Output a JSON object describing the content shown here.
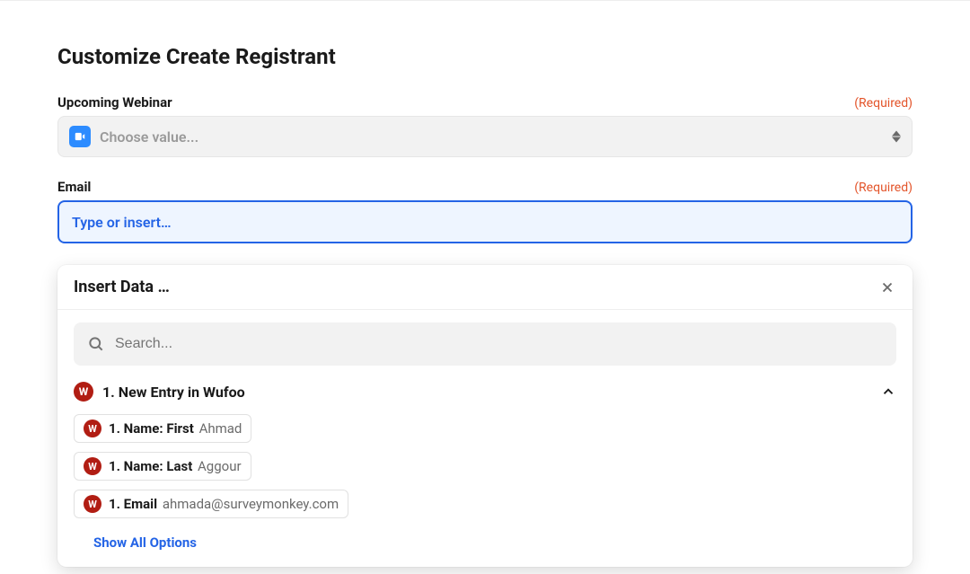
{
  "title": "Customize Create Registrant",
  "fields": {
    "webinar": {
      "label": "Upcoming Webinar",
      "required": "(Required)",
      "placeholder": "Choose value...",
      "icon": "zoom-icon"
    },
    "email": {
      "label": "Email",
      "required": "(Required)",
      "placeholder": "Type or insert…"
    }
  },
  "dropdown": {
    "title": "Insert Data …",
    "search_placeholder": "Search...",
    "group": {
      "icon": "wufoo-icon",
      "title": "1. New Entry in Wufoo",
      "expanded": true
    },
    "options": [
      {
        "label": "1. Name: First",
        "value": "Ahmad"
      },
      {
        "label": "1. Name: Last",
        "value": "Aggour"
      },
      {
        "label": "1. Email",
        "value": "ahmada@surveymonkey.com"
      }
    ],
    "show_all": "Show All Options"
  }
}
